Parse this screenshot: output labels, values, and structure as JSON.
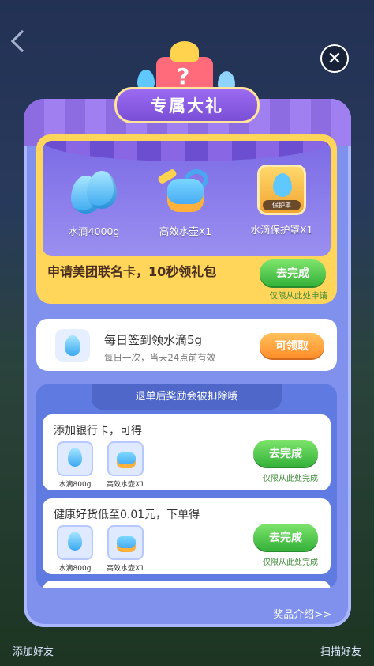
{
  "background": {
    "back_icon": "chevron-left-icon",
    "bottom_left": "添加好友",
    "bottom_right": "扫描好友"
  },
  "modal": {
    "title": "专属大礼",
    "close_icon": "close-icon",
    "rewards": [
      {
        "label": "水滴4000g",
        "icon": "water-drop-icon"
      },
      {
        "label": "高效水壶X1",
        "icon": "watering-can-icon"
      },
      {
        "label": "水滴保护罩X1",
        "icon": "shield-icon",
        "tag": "保护罩"
      }
    ],
    "apply_text": "申请美团联名卡，10秒领礼包",
    "apply_button": "去完成",
    "apply_hint": "仅限从此处申请"
  },
  "daily": {
    "title": "每日签到领水滴5g",
    "subtitle": "每日一次，当天24点前有效",
    "button": "可领取"
  },
  "tasks": {
    "header": "退单后奖励会被扣除哦",
    "items": [
      {
        "title": "添加银行卡，可得",
        "rewards": [
          {
            "label": "水滴800g",
            "icon": "water-drop-icon"
          },
          {
            "label": "高效水壶X1",
            "icon": "watering-can-icon"
          }
        ],
        "button": "去完成",
        "hint": "仅限从此处完成"
      },
      {
        "title": "健康好货低至0.01元，下单得",
        "rewards": [
          {
            "label": "水滴800g",
            "icon": "water-drop-icon"
          },
          {
            "label": "高效水壶X1",
            "icon": "watering-can-icon"
          }
        ],
        "button": "去完成",
        "hint": "仅限从此处完成"
      }
    ]
  },
  "intro_link": "奖品介绍>>",
  "colors": {
    "modal_bg": "#7f91ec",
    "stage_gold": "#ffd65a",
    "green_button": "#35b23a",
    "orange_button": "#ff8d2a"
  }
}
